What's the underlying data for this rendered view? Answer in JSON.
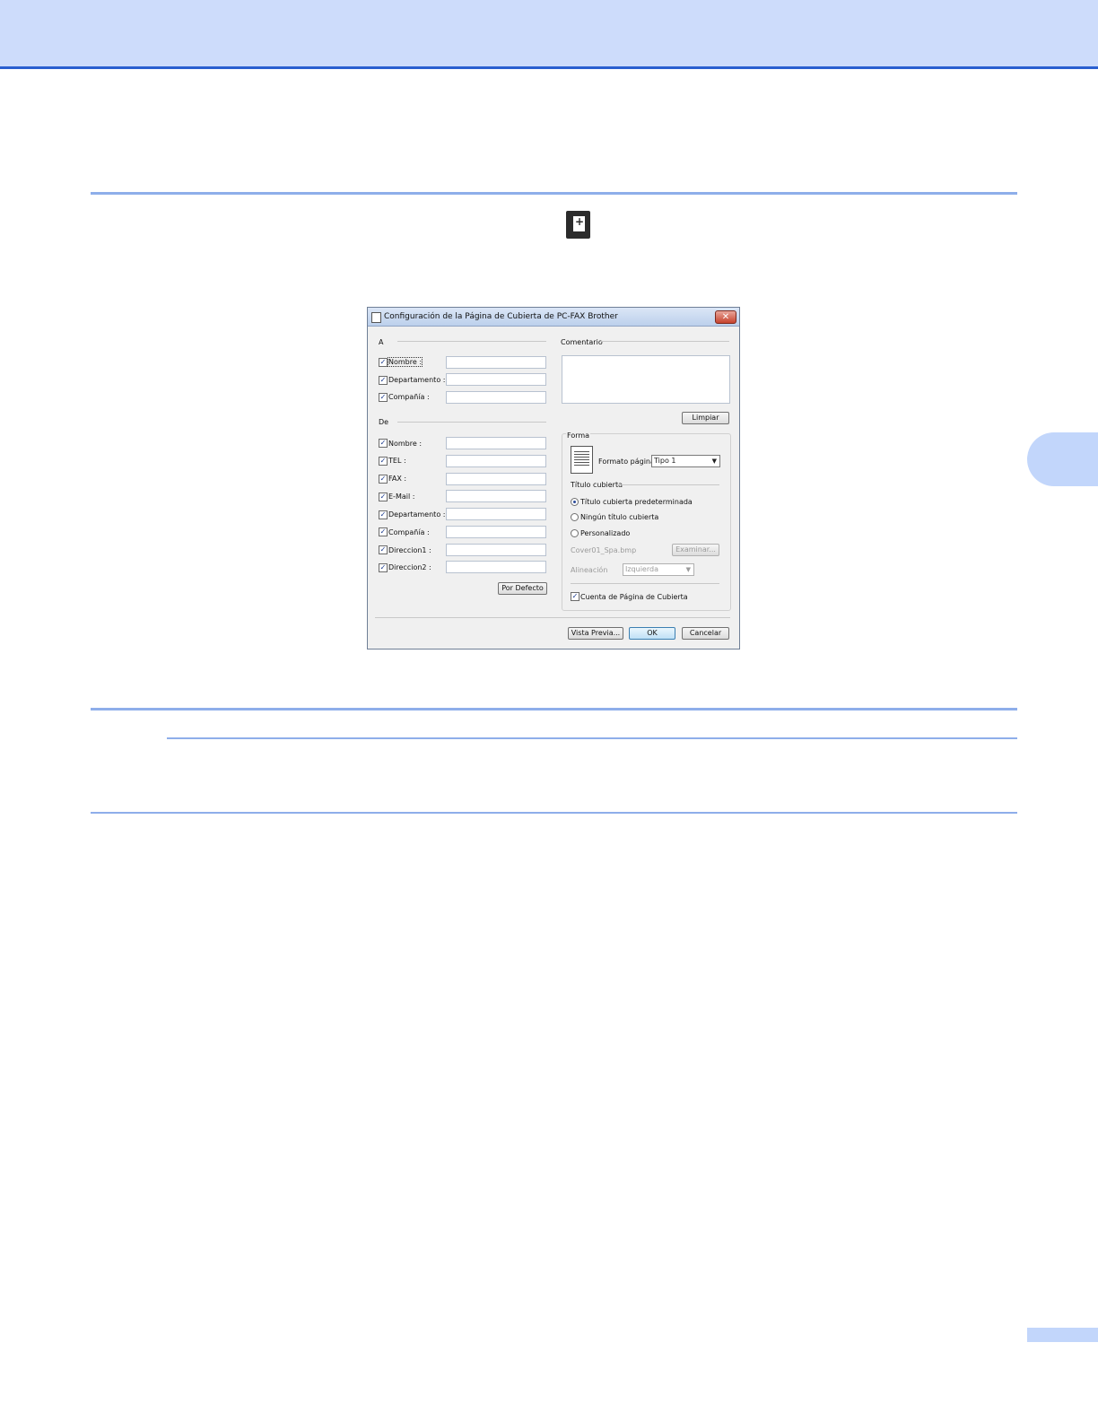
{
  "dialog": {
    "title": "Configuración de la Página de Cubierta de PC-FAX Brother",
    "close_label": "✕",
    "to_section": {
      "heading": "A",
      "fields": [
        {
          "label": "Nombre :",
          "checked": true
        },
        {
          "label": "Departamento :",
          "checked": true
        },
        {
          "label": "Compañía :",
          "checked": true
        }
      ]
    },
    "from_section": {
      "heading": "De",
      "fields": [
        {
          "label": "Nombre :",
          "checked": true
        },
        {
          "label": "TEL :",
          "checked": true
        },
        {
          "label": "FAX :",
          "checked": true
        },
        {
          "label": "E-Mail :",
          "checked": true
        },
        {
          "label": "Departamento :",
          "checked": true
        },
        {
          "label": "Compañía :",
          "checked": true
        },
        {
          "label": "Direccion1 :",
          "checked": true
        },
        {
          "label": "Direccion2 :",
          "checked": true
        }
      ]
    },
    "default_button": "Por Defecto",
    "comment": {
      "heading": "Comentario",
      "clear_button": "Limpiar"
    },
    "form": {
      "heading": "Forma",
      "page_format_label": "Formato página",
      "page_format_value": "Tipo 1",
      "cover_title_heading": "Título cubierta",
      "options": [
        {
          "label": "Título cubierta predeterminada",
          "selected": true
        },
        {
          "label": "Ningún título cubierta",
          "selected": false
        },
        {
          "label": "Personalizado",
          "selected": false
        }
      ],
      "file_name": "Cover01_Spa.bmp",
      "browse_button": "Examinar...",
      "alignment_label": "Alineación",
      "alignment_value": "Izquierda",
      "count_cover_label": "Cuenta de Página de Cubierta",
      "count_cover_checked": true
    },
    "buttons": {
      "preview": "Vista Previa...",
      "ok": "OK",
      "cancel": "Cancelar"
    }
  },
  "check_mark": "✓"
}
